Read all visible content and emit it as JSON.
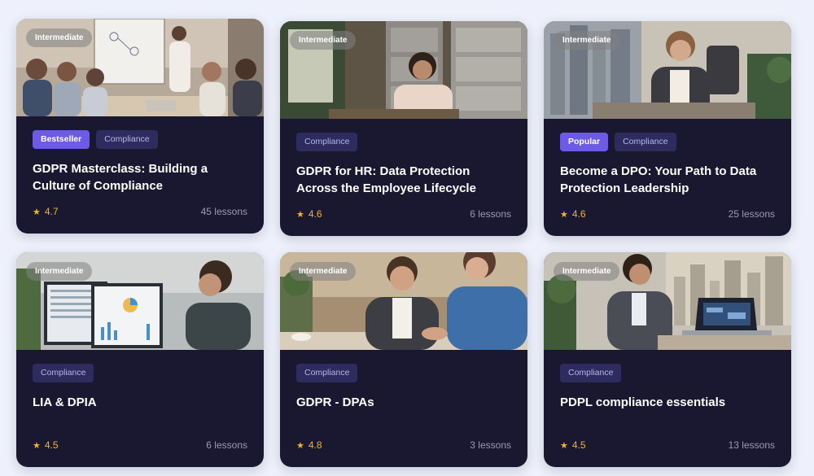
{
  "courses": [
    {
      "level": "Intermediate",
      "tags": [
        {
          "label": "Bestseller",
          "style": "accent"
        },
        {
          "label": "Compliance",
          "style": "muted"
        }
      ],
      "title": "GDPR Masterclass: Building a Culture of Compliance",
      "rating": "4.7",
      "lessons": "45 lessons",
      "thumb": "meeting-whiteboard"
    },
    {
      "level": "Intermediate",
      "tags": [
        {
          "label": "Compliance",
          "style": "muted"
        }
      ],
      "title": "GDPR for HR: Data Protection Across the Employee Lifecycle",
      "rating": "4.6",
      "lessons": "6 lessons",
      "thumb": "filing-cabinet"
    },
    {
      "level": "Intermediate",
      "tags": [
        {
          "label": "Popular",
          "style": "accent"
        },
        {
          "label": "Compliance",
          "style": "muted"
        }
      ],
      "title": "Become a DPO: Your Path to Data Protection Leadership",
      "rating": "4.6",
      "lessons": "25 lessons",
      "thumb": "executive-office"
    },
    {
      "level": "Intermediate",
      "tags": [
        {
          "label": "Compliance",
          "style": "muted"
        }
      ],
      "title": "LIA & DPIA",
      "rating": "4.5",
      "lessons": "6 lessons",
      "thumb": "analytics-monitors"
    },
    {
      "level": "Intermediate",
      "tags": [
        {
          "label": "Compliance",
          "style": "muted"
        }
      ],
      "title": "GDPR - DPAs",
      "rating": "4.8",
      "lessons": "3 lessons",
      "thumb": "business-handshake"
    },
    {
      "level": "Intermediate",
      "tags": [
        {
          "label": "Compliance",
          "style": "muted"
        }
      ],
      "title": "PDPL compliance essentials",
      "rating": "4.5",
      "lessons": "13 lessons",
      "thumb": "laptop-city"
    }
  ],
  "colors": {
    "page_bg": "#eef1fb",
    "card_bg": "#191830",
    "accent_tag": "#6d5ae6",
    "muted_tag": "#2e2c5e",
    "rating": "#f0b429"
  }
}
